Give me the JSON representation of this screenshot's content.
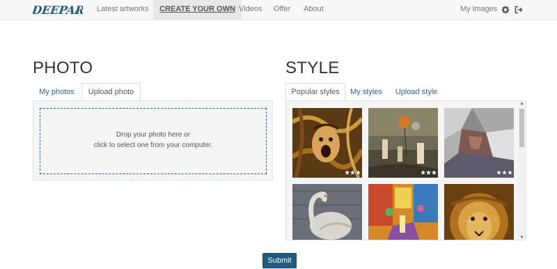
{
  "brand": {
    "logo_text": "DEEPART.io"
  },
  "nav": {
    "items": [
      {
        "label": "Latest artworks"
      },
      {
        "label": "CREATE YOUR OWN"
      },
      {
        "label": "Videos"
      },
      {
        "label": "Offer"
      },
      {
        "label": "About"
      }
    ],
    "my_images": "My images",
    "settings_icon": "gear-icon",
    "logout_icon": "logout-icon"
  },
  "photo": {
    "heading": "PHOTO",
    "tabs": [
      {
        "label": "My photos"
      },
      {
        "label": "Upload photo"
      }
    ],
    "active_tab": "Upload photo",
    "drop_line1": "Drop your photo here or",
    "drop_line2": "click to select one from your computer."
  },
  "style": {
    "heading": "STYLE",
    "tabs": [
      {
        "label": "Popular styles"
      },
      {
        "label": "My styles"
      },
      {
        "label": "Upload style"
      }
    ],
    "active_tab": "Popular styles",
    "thumbnails": [
      {
        "name": "screaming-face-style",
        "rating": "★★★"
      },
      {
        "name": "balloon-street-style",
        "rating": "★★★"
      },
      {
        "name": "crumpled-paper-style",
        "rating": "★★★"
      },
      {
        "name": "swan-style",
        "rating": ""
      },
      {
        "name": "colorful-street-style",
        "rating": ""
      },
      {
        "name": "lion-style",
        "rating": ""
      }
    ]
  },
  "submit": {
    "label": "Submit"
  },
  "colors": {
    "primary": "#1f5b80",
    "link": "#2a6496",
    "dashed_border": "#1f5f86"
  }
}
